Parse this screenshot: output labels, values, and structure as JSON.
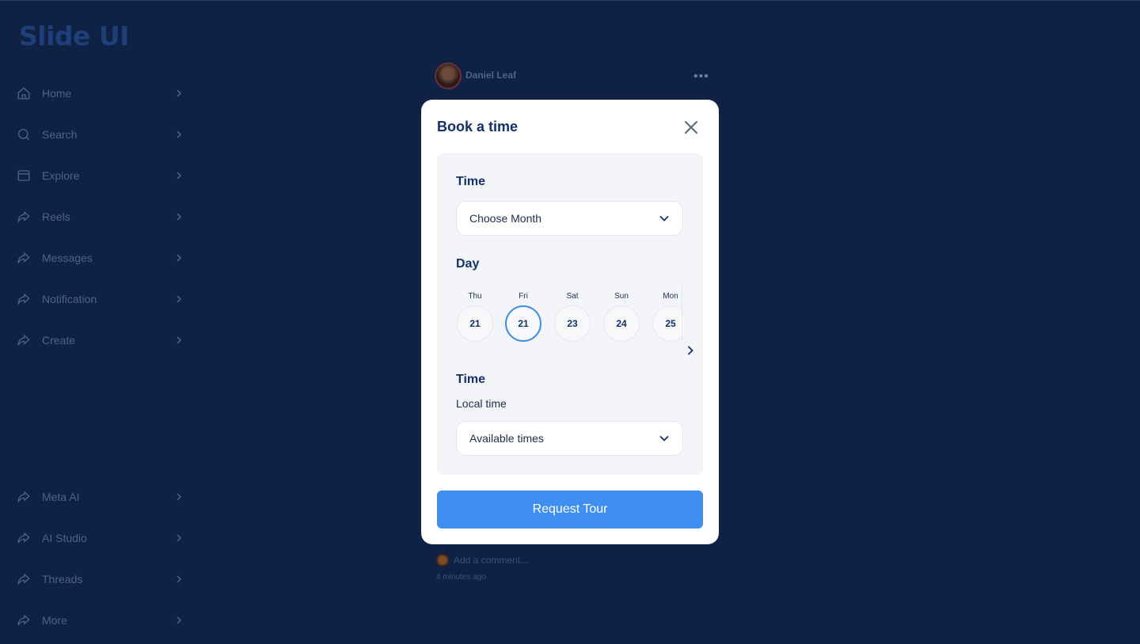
{
  "brand": "Slide UI",
  "nav": {
    "top": [
      {
        "label": "Home",
        "icon": "home-icon"
      },
      {
        "label": "Search",
        "icon": "search-icon"
      },
      {
        "label": "Explore",
        "icon": "explore-icon"
      },
      {
        "label": "Reels",
        "icon": "share-arrow-icon"
      },
      {
        "label": "Messages",
        "icon": "share-arrow-icon"
      },
      {
        "label": "Notification",
        "icon": "share-arrow-icon"
      },
      {
        "label": "Create",
        "icon": "share-arrow-icon"
      }
    ],
    "bottom": [
      {
        "label": "Meta AI",
        "icon": "share-arrow-icon"
      },
      {
        "label": "AI Studio",
        "icon": "share-arrow-icon"
      },
      {
        "label": "Threads",
        "icon": "share-arrow-icon"
      },
      {
        "label": "More",
        "icon": "share-arrow-icon"
      }
    ]
  },
  "post": {
    "author": "Daniel Leaf",
    "comment_placeholder": "Add a comment...",
    "time_ago": "4 minutes ago"
  },
  "modal": {
    "title": "Book a time",
    "time_label": "Time",
    "month_select": "Choose Month",
    "day_label": "Day",
    "days": [
      {
        "name": "Thu",
        "num": "21",
        "selected": false
      },
      {
        "name": "Fri",
        "num": "21",
        "selected": true
      },
      {
        "name": "Sat",
        "num": "23",
        "selected": false
      },
      {
        "name": "Sun",
        "num": "24",
        "selected": false
      },
      {
        "name": "Mon",
        "num": "25",
        "selected": false
      }
    ],
    "time_label_2": "Time",
    "local_time": "Local time",
    "times_select": "Available times",
    "button": "Request Tour"
  },
  "colors": {
    "background": "#0f2144",
    "accent": "#3f8ff0",
    "heading": "#12306a"
  }
}
